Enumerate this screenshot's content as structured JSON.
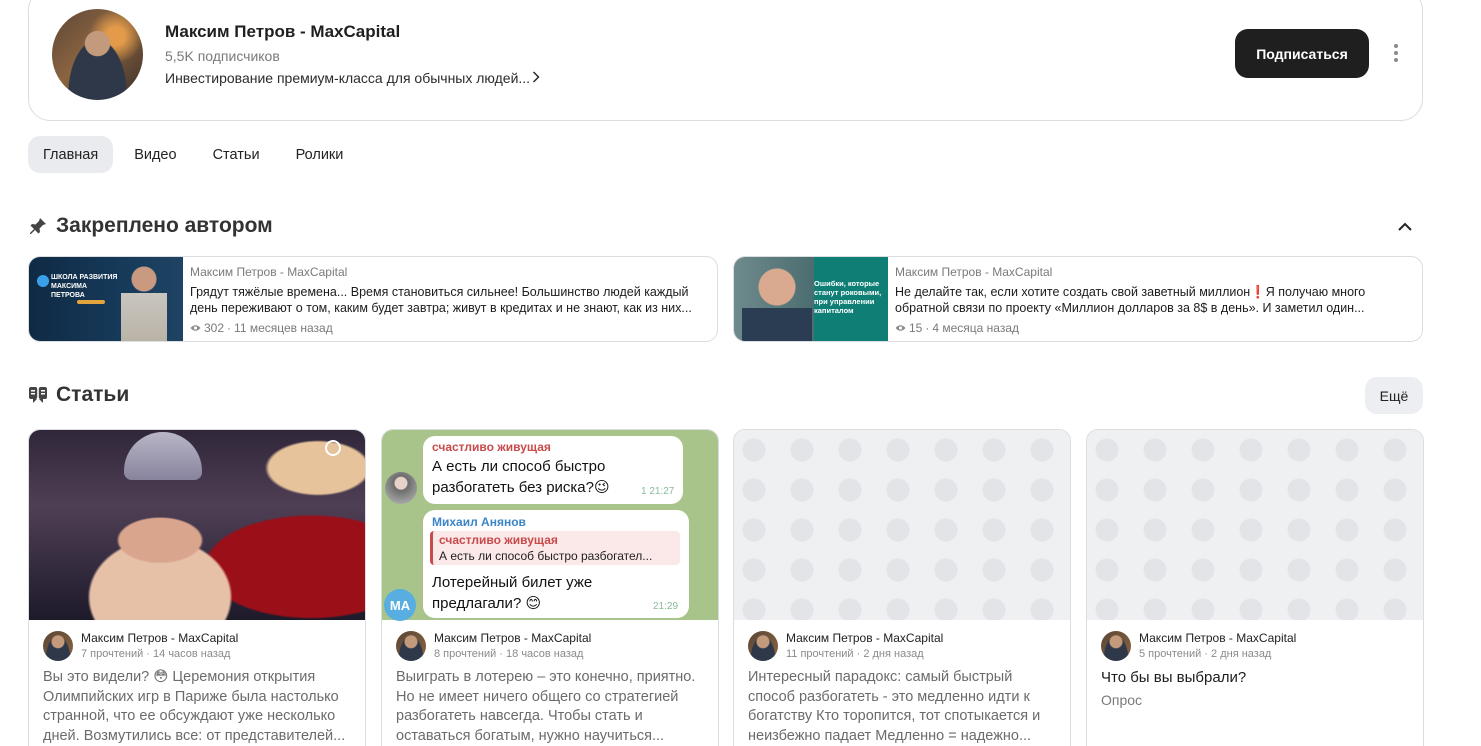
{
  "channel": {
    "name": "Максим Петров - MaxCapital",
    "subscribers": "5,5K подписчиков",
    "description": "Инвестирование премиум-класса для обычных людей...",
    "subscribe_label": "Подписаться"
  },
  "tabs": [
    {
      "label": "Главная",
      "active": true
    },
    {
      "label": "Видео",
      "active": false
    },
    {
      "label": "Статьи",
      "active": false
    },
    {
      "label": "Ролики",
      "active": false
    }
  ],
  "pinned": {
    "title": "Закреплено автором",
    "items": [
      {
        "author": "Максим Петров - MaxCapital",
        "text": "Грядут тяжёлые времена... Время становиться сильнее! Большинство людей каждый день переживают о том, каким будет завтра; живут в кредитах и не знают, как из них...",
        "views": "302",
        "age": "11 месяцев назад",
        "thumb_text": "ШКОЛА РАЗВИТИЯ МАКСИМА ПЕТРОВА"
      },
      {
        "author": "Максим Петров - MaxCapital",
        "text": "Не делайте так, если хотите создать свой заветный миллион❗Я получаю много обратной связи по проекту «Миллион долларов за 8$ в день». И заметил один...",
        "views": "15",
        "age": "4 месяца назад",
        "thumb_text": "Ошибки, которые станут роковыми, при управлении капиталом"
      }
    ]
  },
  "articles": {
    "title": "Статьи",
    "more_label": "Ещё",
    "items": [
      {
        "author": "Максим Петров - MaxCapital",
        "meta": "7 прочтений · 14 часов назад",
        "text": "Вы это видели? 😳 Церемония открытия Олимпийских игр в Париже была настолько странной, что ее обсуждают уже несколько дней. Возмутились все: от представителей..."
      },
      {
        "author": "Максим Петров - MaxCapital",
        "meta": "8 прочтений · 18 часов назад",
        "text": "Выиграть в лотерею – это конечно, приятно. Но не имеет ничего общего со стратегией разбогатеть навсегда. Чтобы стать и оставаться богатым, нужно научиться...",
        "chat": {
          "name1": "счастливо живущая",
          "msg1": "А есть ли способ быстро разбогатеть без риска?😉",
          "time1": "1  21:27",
          "name2": "Михаил Анянов",
          "quote_name": "счастливо живущая",
          "quote_text": "А есть ли способ быстро разбогател...",
          "msg2": "Лотерейный билет уже предлагали? 😊",
          "time2": "21:29",
          "avatar2": "MA"
        }
      },
      {
        "author": "Максим Петров - MaxCapital",
        "meta": "11 прочтений · 2 дня назад",
        "text": "Интересный парадокс: самый быстрый способ разбогатеть - это медленно идти к богатству Кто торопится, тот спотыкается и неизбежно падает Медленно = надежно..."
      },
      {
        "author": "Максим Петров - MaxCapital",
        "meta": "5 прочтений · 2 дня назад",
        "title": "Что бы вы выбрали?",
        "subtitle": "Опрос"
      }
    ]
  }
}
